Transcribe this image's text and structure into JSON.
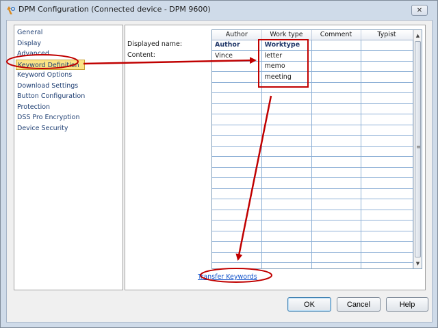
{
  "window": {
    "title": "DPM Configuration (Connected device - DPM 9600)",
    "close_glyph": "✕"
  },
  "sidebar": {
    "items": [
      {
        "label": "General"
      },
      {
        "label": "Display"
      },
      {
        "label": "Advanced"
      },
      {
        "label": "Keyword Definition",
        "selected": true
      },
      {
        "label": "Keyword Options"
      },
      {
        "label": "Download Settings"
      },
      {
        "label": "Button Configuration"
      },
      {
        "label": "Protection"
      },
      {
        "label": "DSS Pro Encryption"
      },
      {
        "label": "Device Security"
      }
    ]
  },
  "form": {
    "displayed_name_label": "Displayed name:",
    "content_label": "Content:"
  },
  "grid": {
    "columns": [
      "Author",
      "Work type",
      "Comment",
      "Typist"
    ],
    "name_row": [
      "Author",
      "Worktype",
      "",
      ""
    ],
    "content_rows": [
      [
        "Vince",
        "letter",
        "",
        ""
      ],
      [
        "",
        "memo",
        "",
        ""
      ],
      [
        "",
        "meeting",
        "",
        ""
      ]
    ]
  },
  "link": {
    "transfer_keywords": "Transfer Keywords"
  },
  "buttons": {
    "ok": "OK",
    "cancel": "Cancel",
    "help": "Help"
  },
  "colors": {
    "annotation_red": "#c00000",
    "selection_yellow": "#fbe486",
    "link_blue": "#0b4ec9"
  },
  "icons": {
    "app": "dpm-app-icon",
    "close": "close-icon",
    "scroll_up": "scroll-up-arrow-icon",
    "scroll_down": "scroll-down-arrow-icon",
    "grip": "scrollbar-grip-icon"
  }
}
